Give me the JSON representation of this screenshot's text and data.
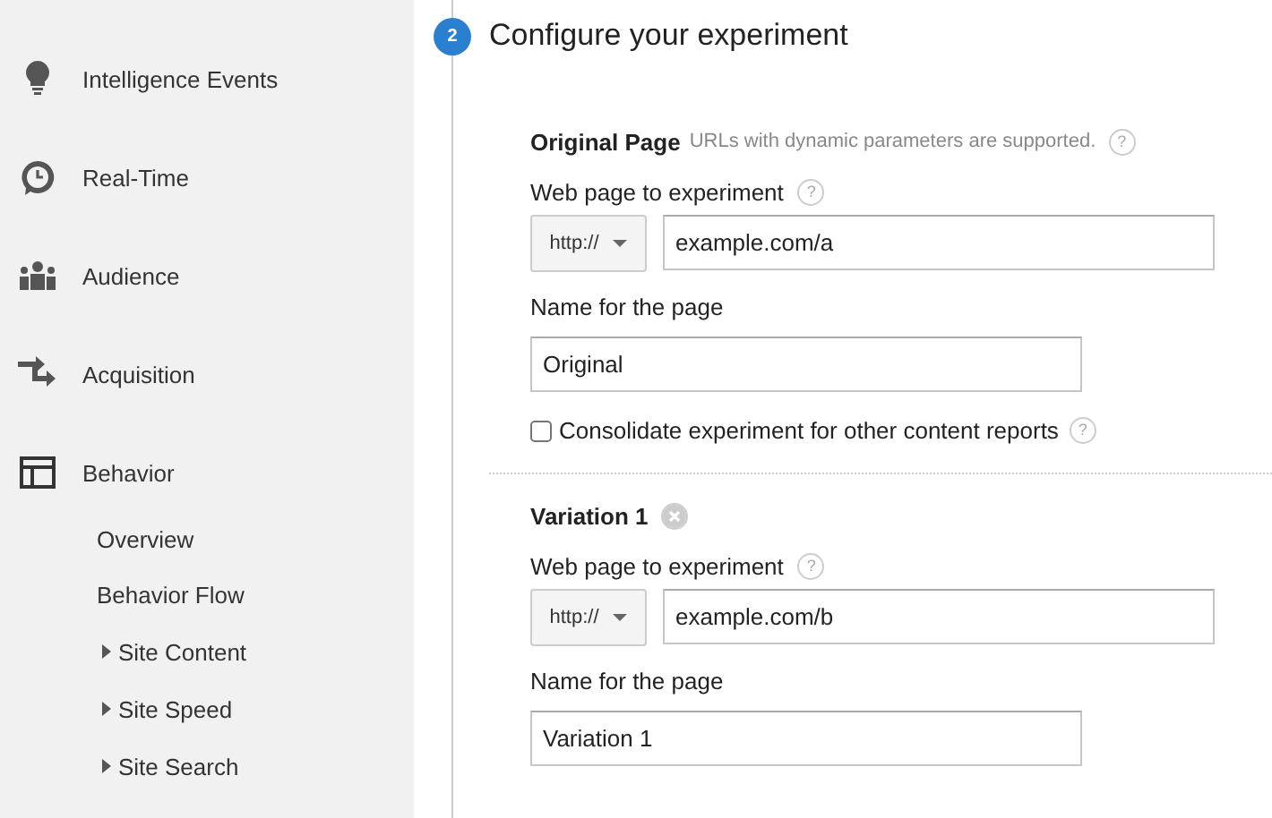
{
  "sidebar": {
    "items": [
      {
        "label": "Intelligence Events"
      },
      {
        "label": "Real-Time"
      },
      {
        "label": "Audience"
      },
      {
        "label": "Acquisition"
      },
      {
        "label": "Behavior",
        "children": [
          {
            "label": "Overview",
            "has_children": false
          },
          {
            "label": "Behavior Flow",
            "has_children": false
          },
          {
            "label": "Site Content",
            "has_children": true
          },
          {
            "label": "Site Speed",
            "has_children": true
          },
          {
            "label": "Site Search",
            "has_children": true
          }
        ]
      }
    ]
  },
  "step": {
    "number": "2",
    "title": "Configure your experiment"
  },
  "pages": [
    {
      "heading": "Original Page",
      "note": "URLs with dynamic parameters are supported.",
      "note_help": "?",
      "removable": false,
      "url_label": "Web page to experiment",
      "url_help": "?",
      "protocol": "http://",
      "url": "example.com/a",
      "name_label": "Name for the page",
      "name": "Original",
      "consolidate": {
        "label": "Consolidate experiment for other content reports",
        "help": "?",
        "checked": false
      }
    },
    {
      "heading": "Variation 1",
      "removable": true,
      "url_label": "Web page to experiment",
      "url_help": "?",
      "protocol": "http://",
      "url": "example.com/b",
      "name_label": "Name for the page",
      "name": "Variation 1"
    }
  ]
}
